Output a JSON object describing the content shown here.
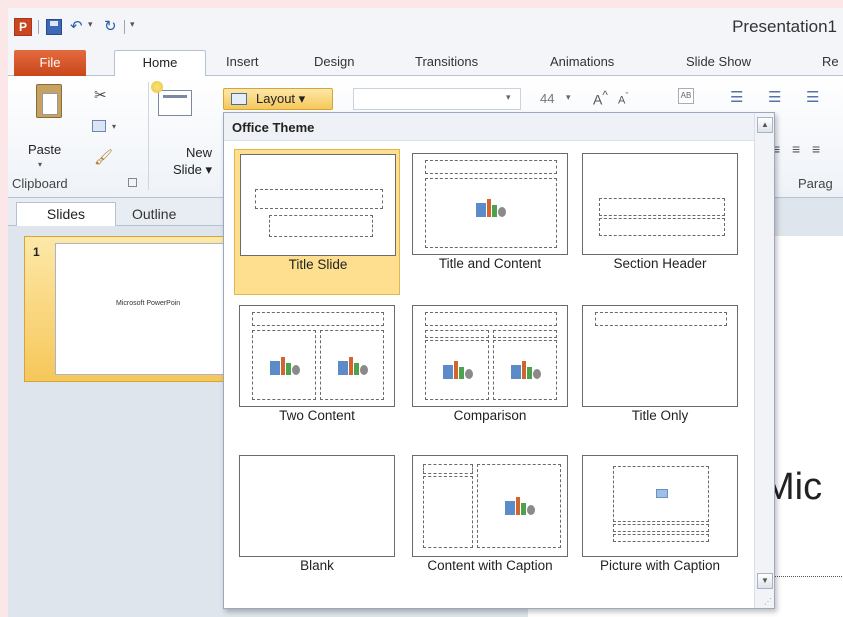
{
  "window": {
    "title": "Presentation1"
  },
  "quick_access": {
    "app_icon": "P"
  },
  "tabs": {
    "file": "File",
    "home": "Home",
    "insert": "Insert",
    "design": "Design",
    "transitions": "Transitions",
    "animations": "Animations",
    "slideshow": "Slide Show",
    "review_partial": "Re"
  },
  "ribbon": {
    "paste_label": "Paste",
    "new_slide_label_1": "New",
    "new_slide_label_2": "Slide",
    "clipboard_group": "Clipboard",
    "layout_button": "Layout",
    "font_size": "44",
    "clear_formatting_glyph": "AB",
    "paragraph_group": "Parag"
  },
  "left_pane": {
    "tab_slides": "Slides",
    "tab_outline": "Outline",
    "slide_number": "1",
    "thumb_text": "Microsoft PowerPoin"
  },
  "slide": {
    "title_visible": "Mic"
  },
  "layout_gallery": {
    "header": "Office Theme",
    "items": [
      {
        "label": "Title Slide",
        "selected": true
      },
      {
        "label": "Title and Content"
      },
      {
        "label": "Section Header"
      },
      {
        "label": "Two Content"
      },
      {
        "label": "Comparison"
      },
      {
        "label": "Title Only"
      },
      {
        "label": "Blank"
      },
      {
        "label": "Content with Caption"
      },
      {
        "label": "Picture with Caption"
      }
    ]
  },
  "colors": {
    "file_tab": "#d8572a",
    "selection": "#fddf8f",
    "accent": "#2c5ea8"
  }
}
